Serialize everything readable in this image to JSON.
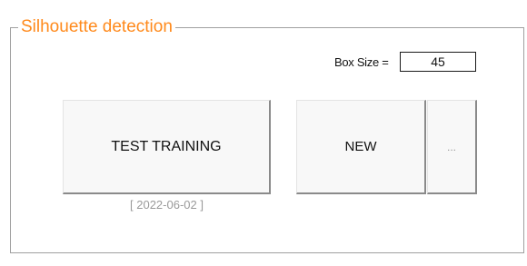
{
  "group": {
    "title": "Silhouette detection"
  },
  "box_size": {
    "label": "Box Size =",
    "value": "45"
  },
  "buttons": {
    "test_training": "TEST TRAINING",
    "new": "NEW",
    "more": "..."
  },
  "training_date": "[ 2022-06-02 ]",
  "colors": {
    "title_accent": "#ff8a1c",
    "date_text": "#9a9a9a"
  }
}
